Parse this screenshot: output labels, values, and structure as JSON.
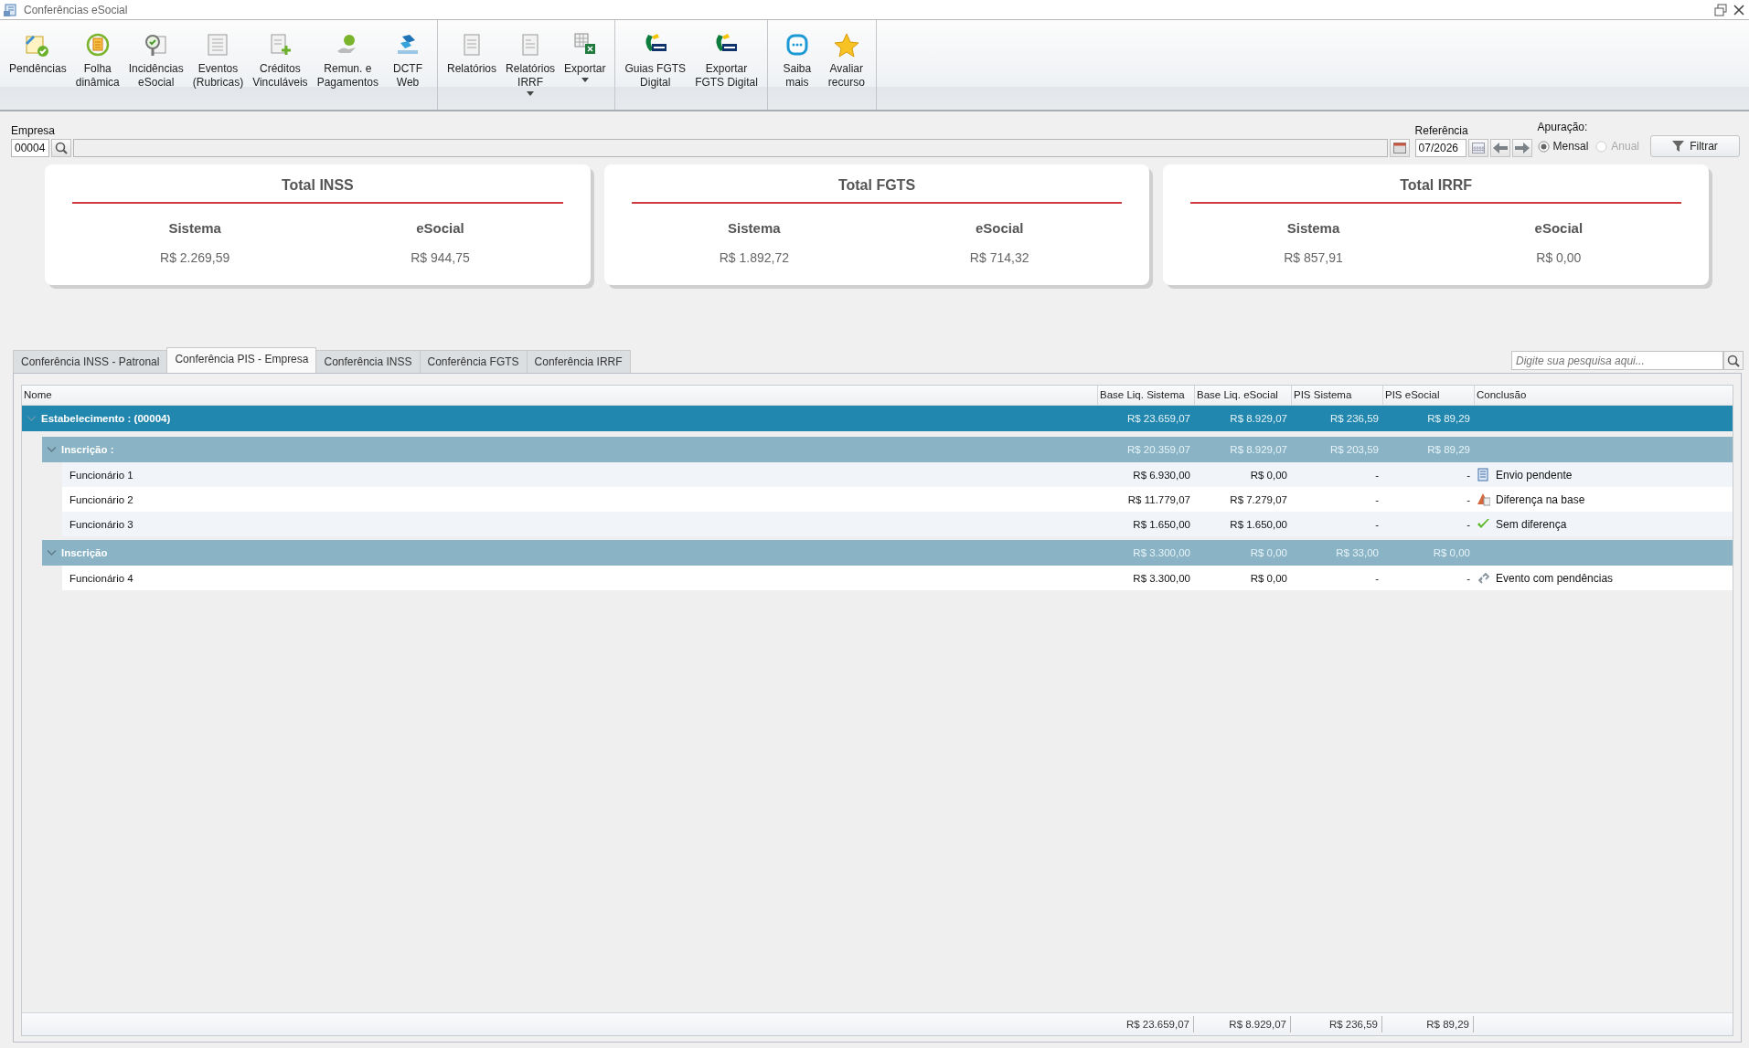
{
  "window": {
    "title": "Conferências eSocial"
  },
  "toolbar": {
    "groups": [
      {
        "items": [
          {
            "lines": [
              "Pendências"
            ],
            "dropdown": false
          },
          {
            "lines": [
              "Folha",
              "dinâmica"
            ],
            "dropdown": false
          },
          {
            "lines": [
              "Incidências",
              "eSocial"
            ],
            "dropdown": false
          },
          {
            "lines": [
              "Eventos",
              "(Rubricas)"
            ],
            "dropdown": false
          },
          {
            "lines": [
              "Créditos",
              "Vinculáveis"
            ],
            "dropdown": false
          },
          {
            "lines": [
              "Remun. e",
              "Pagamentos"
            ],
            "dropdown": false
          },
          {
            "lines": [
              "DCTF",
              "Web"
            ],
            "dropdown": false
          }
        ]
      },
      {
        "items": [
          {
            "lines": [
              "Relatórios"
            ],
            "dropdown": false
          },
          {
            "lines": [
              "Relatórios",
              "IRRF"
            ],
            "dropdown": true
          },
          {
            "lines": [
              "Exportar"
            ],
            "dropdown": true
          }
        ]
      },
      {
        "items": [
          {
            "lines": [
              "Guias FGTS",
              "Digital"
            ],
            "dropdown": false
          },
          {
            "lines": [
              "Exportar",
              "FGTS Digital"
            ],
            "dropdown": false
          }
        ]
      },
      {
        "items": [
          {
            "lines": [
              "Saiba",
              "mais"
            ],
            "dropdown": false
          },
          {
            "lines": [
              "Avaliar",
              "recurso"
            ],
            "dropdown": false
          }
        ]
      }
    ]
  },
  "filter": {
    "empresa_label": "Empresa",
    "empresa_code": "00004",
    "referencia_label": "Referência",
    "referencia": "07/2026",
    "apuracao_label": "Apuração:",
    "apuracao_options": [
      {
        "label": "Mensal",
        "selected": true,
        "disabled": false
      },
      {
        "label": "Anual",
        "selected": false,
        "disabled": true
      }
    ],
    "filter_button": "Filtrar"
  },
  "totals": [
    {
      "title": "Total INSS",
      "sistema_label": "Sistema",
      "sistema": "R$ 2.269,59",
      "esocial_label": "eSocial",
      "esocial": "R$ 944,75"
    },
    {
      "title": "Total FGTS",
      "sistema_label": "Sistema",
      "sistema": "R$ 1.892,72",
      "esocial_label": "eSocial",
      "esocial": "R$ 714,32"
    },
    {
      "title": "Total IRRF",
      "sistema_label": "Sistema",
      "sistema": "R$ 857,91",
      "esocial_label": "eSocial",
      "esocial": "R$ 0,00"
    }
  ],
  "tabs": [
    {
      "label": "Conferência INSS - Patronal",
      "selected": false
    },
    {
      "label": "Conferência PIS - Empresa",
      "selected": true
    },
    {
      "label": "Conferência INSS",
      "selected": false
    },
    {
      "label": "Conferência FGTS",
      "selected": false
    },
    {
      "label": "Conferência IRRF",
      "selected": false
    }
  ],
  "search": {
    "placeholder": "Digite sua pesquisa aqui..."
  },
  "table": {
    "columns": [
      "Nome",
      "Base Liq. Sistema",
      "Base Liq. eSocial",
      "PIS Sistema",
      "PIS eSocial",
      "Conclusão"
    ],
    "rows": [
      {
        "cells": [
          "Estabelecimento : (00004)",
          "R$ 23.659,07",
          "R$ 8.929,07",
          "R$ 236,59",
          "R$ 89,29"
        ],
        "expanded": true,
        "children": [
          {
            "cells": [
              "Inscrição :",
              "R$ 20.359,07",
              "R$ 8.929,07",
              "R$ 203,59",
              "R$ 89,29"
            ],
            "expanded": true,
            "children": [
              {
                "cells": [
                  "Funcionário 1",
                  "R$ 6.930,00",
                  "R$ 0,00",
                  "-",
                  "-",
                  "Envio pendente"
                ],
                "kind": "pending"
              },
              {
                "cells": [
                  "Funcionário 2",
                  "R$ 11.779,07",
                  "R$ 7.279,07",
                  "-",
                  "-",
                  "Diferença na base"
                ],
                "kind": "difference"
              },
              {
                "cells": [
                  "Funcionário 3",
                  "R$ 1.650,00",
                  "R$ 1.650,00",
                  "-",
                  "-",
                  "Sem diferença"
                ],
                "kind": "ok"
              }
            ]
          },
          {
            "cells": [
              "Inscrição",
              "R$ 3.300,00",
              "R$ 0,00",
              "R$ 33,00",
              "R$ 0,00"
            ],
            "expanded": true,
            "children": [
              {
                "cells": [
                  "Funcionário 4",
                  "R$ 3.300,00",
                  "R$ 0,00",
                  "-",
                  "-",
                  "Evento com pendências"
                ],
                "kind": "linked"
              }
            ]
          }
        ]
      }
    ],
    "footer": [
      "R$ 23.659,07",
      "R$ 8.929,07",
      "R$ 236,59",
      "R$ 89,29"
    ]
  }
}
